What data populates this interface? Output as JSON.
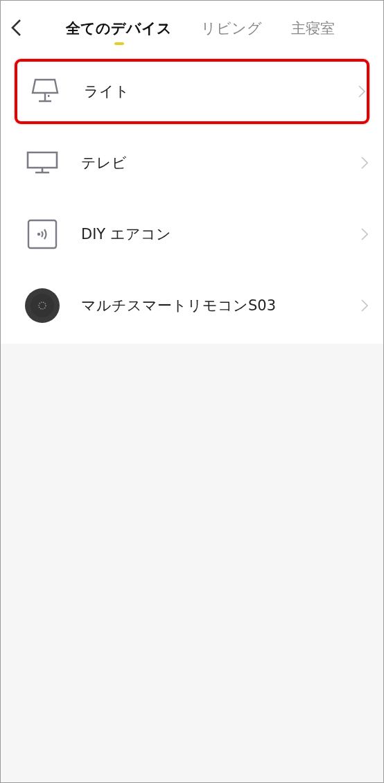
{
  "tabs": [
    {
      "label": "全てのデバイス",
      "selected": true
    },
    {
      "label": "リビング",
      "selected": false
    },
    {
      "label": "主寝室",
      "selected": false
    }
  ],
  "devices": [
    {
      "name": "ライト",
      "kind": "lamp",
      "highlighted": true
    },
    {
      "name": "テレビ",
      "kind": "tv",
      "highlighted": false
    },
    {
      "name": "DIY エアコン",
      "kind": "remote",
      "highlighted": false
    },
    {
      "name": "マルチスマートリモコンS03",
      "kind": "hub",
      "highlighted": false
    }
  ]
}
